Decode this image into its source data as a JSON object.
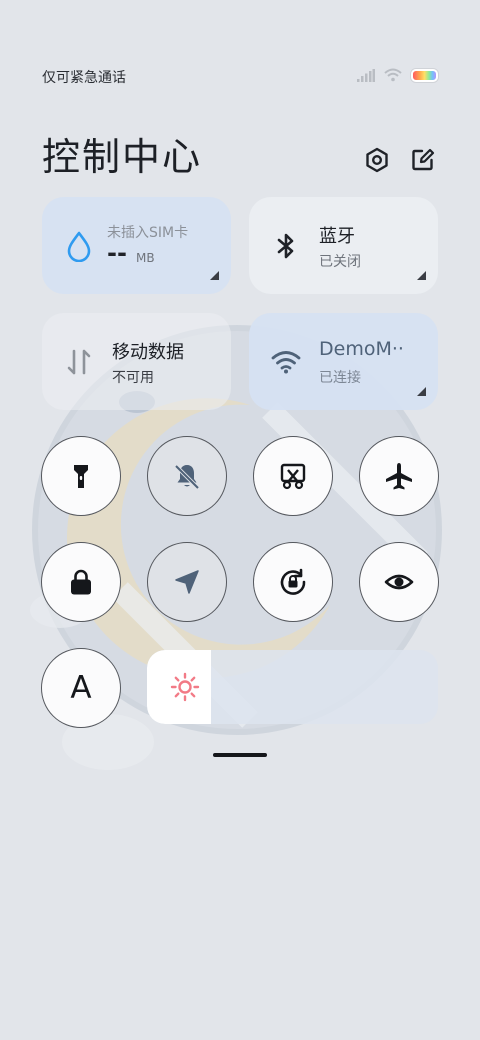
{
  "status_bar": {
    "carrier_text": "仅可紧急通话",
    "icons": [
      "signal-icon",
      "wifi-icon",
      "battery-icon"
    ]
  },
  "header": {
    "title": "控制中心",
    "settings_icon": "gear-icon",
    "edit_icon": "edit-icon"
  },
  "tiles": {
    "data_usage": {
      "title": "未插入SIM卡",
      "value": "--",
      "unit": "MB",
      "icon": "water-drop-icon"
    },
    "bluetooth": {
      "title": "蓝牙",
      "status": "已关闭",
      "icon": "bluetooth-icon"
    },
    "mobile_data": {
      "title": "移动数据",
      "status": "不可用",
      "icon": "data-arrows-icon"
    },
    "wifi": {
      "title": "DemoM··",
      "status": "已连接",
      "icon": "wifi-icon"
    }
  },
  "toggles": [
    {
      "name": "flashlight",
      "icon": "flashlight-icon",
      "state": "off"
    },
    {
      "name": "mute",
      "icon": "bell-off-icon",
      "state": "on"
    },
    {
      "name": "screenshot",
      "icon": "scissors-icon",
      "state": "off"
    },
    {
      "name": "airplane-mode",
      "icon": "airplane-icon",
      "state": "off"
    },
    {
      "name": "lock-screen",
      "icon": "lock-icon",
      "state": "off"
    },
    {
      "name": "location",
      "icon": "navigation-arrow-icon",
      "state": "on"
    },
    {
      "name": "rotation-lock",
      "icon": "rotation-lock-icon",
      "state": "off"
    },
    {
      "name": "reading-mode",
      "icon": "eye-icon",
      "state": "off"
    },
    {
      "name": "font-size",
      "icon": "letter-a-icon",
      "label": "A",
      "state": "off"
    }
  ],
  "brightness": {
    "level": 0.22,
    "icon": "sun-icon"
  },
  "colors": {
    "accent_blue": "#2f9bf0",
    "sun": "#f27a86",
    "background": "#e2e5ea"
  }
}
